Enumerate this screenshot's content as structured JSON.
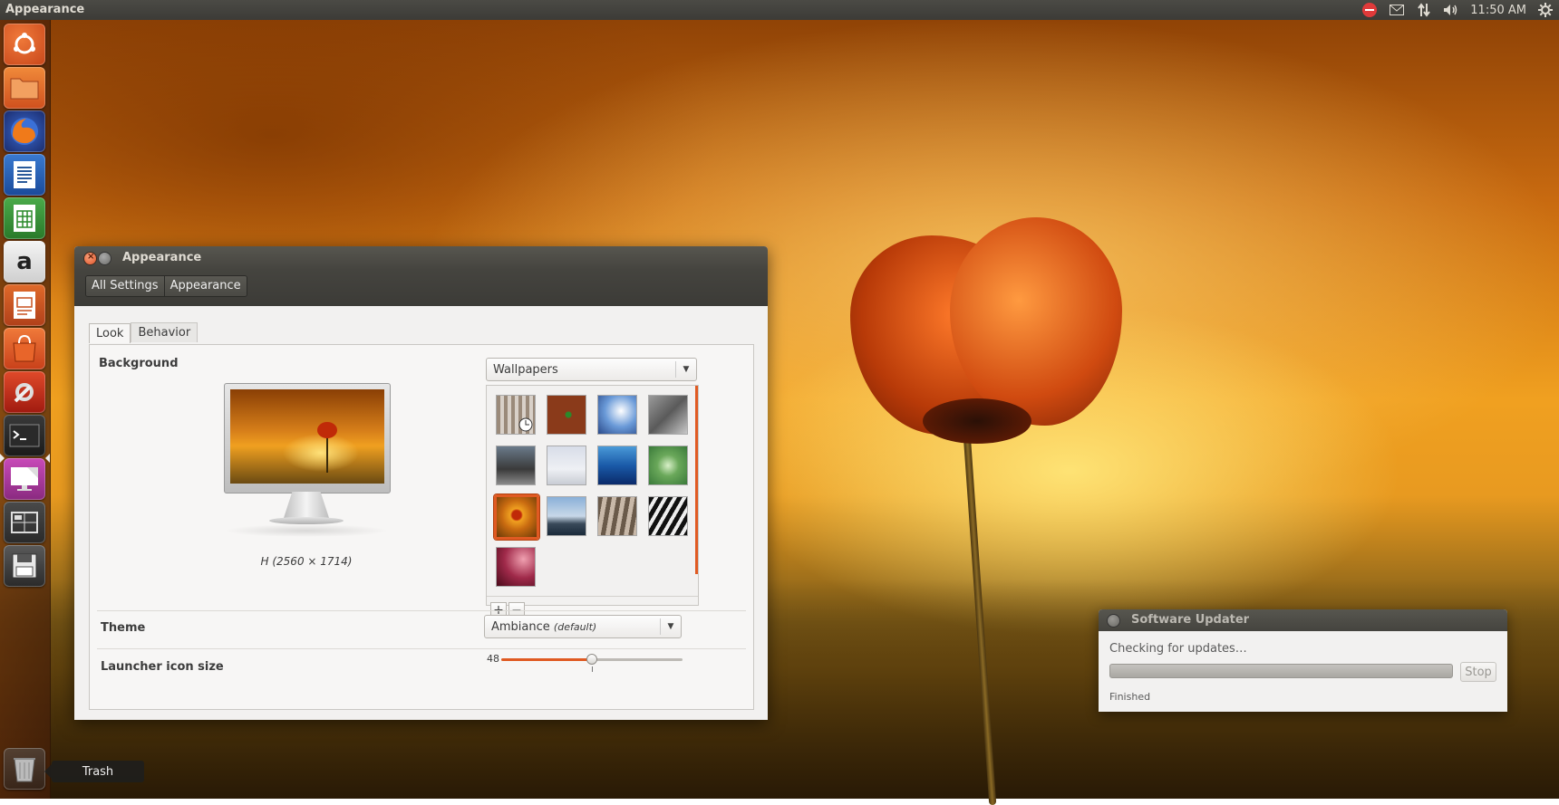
{
  "top_panel": {
    "title": "Appearance",
    "clock": "11:50 AM",
    "indicators": [
      "no-entry-icon",
      "mail-icon",
      "network-icon",
      "volume-icon",
      "gear-icon"
    ]
  },
  "launcher": {
    "items": [
      {
        "name": "ubuntu-dash",
        "color": "#d95a1e"
      },
      {
        "name": "files",
        "color": "#e0612a"
      },
      {
        "name": "firefox",
        "color": "#e86a1c"
      },
      {
        "name": "libreoffice-writer",
        "color": "#2a5a9a"
      },
      {
        "name": "libreoffice-calc",
        "color": "#3a9a3a"
      },
      {
        "name": "amazon",
        "color": "#e0e0e0"
      },
      {
        "name": "libreoffice-impress",
        "color": "#c8501e"
      },
      {
        "name": "software-center",
        "color": "#d8501a"
      },
      {
        "name": "system-settings",
        "color": "#c0281e"
      },
      {
        "name": "terminal",
        "color": "#2a2a2a"
      },
      {
        "name": "appearance",
        "color": "#b83aa8"
      },
      {
        "name": "workspace-switcher",
        "color": "#3a3a3a"
      },
      {
        "name": "save-device",
        "color": "#444444"
      }
    ],
    "trash_tooltip": "Trash"
  },
  "appearance_window": {
    "title": "Appearance",
    "breadcrumbs": [
      "All Settings",
      "Appearance"
    ],
    "tabs": [
      "Look",
      "Behavior"
    ],
    "active_tab": "Look",
    "background_label": "Background",
    "resolution_label": "H (2560 × 1714)",
    "wallpaper_source": "Wallpapers",
    "theme_label": "Theme",
    "theme_value": "Ambiance",
    "theme_suffix": "(default)",
    "launcher_size_label": "Launcher icon size",
    "launcher_size_value": "48",
    "launcher_size_fraction": 0.5,
    "add_symbol": "+",
    "remove_symbol": "−",
    "selected_wallpaper_index": 8,
    "accent": "#e05a22"
  },
  "software_updater": {
    "title": "Software Updater",
    "message": "Checking for updates…",
    "stop_label": "Stop",
    "status": "Finished"
  }
}
